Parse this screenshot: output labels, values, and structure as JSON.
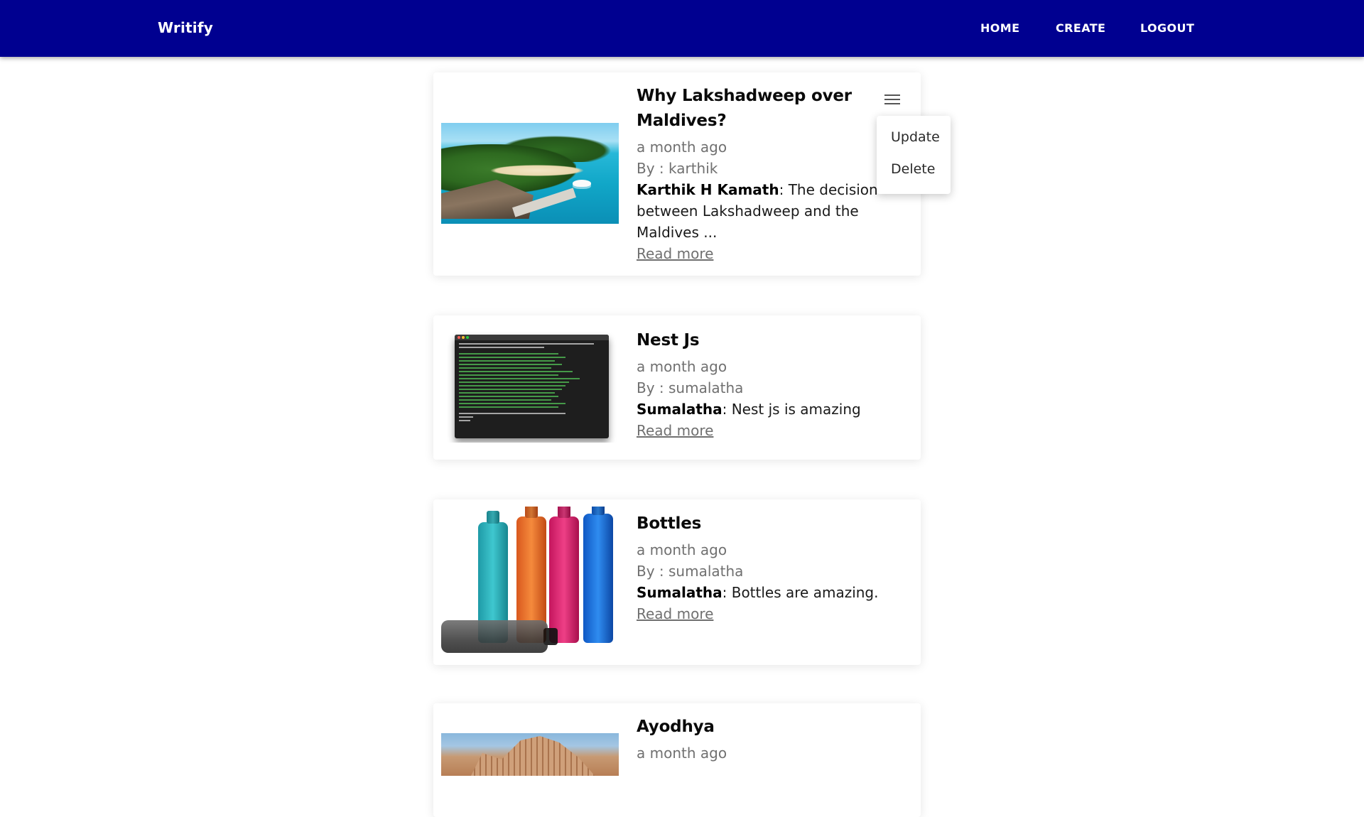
{
  "navbar": {
    "brand": "Writify",
    "links": {
      "home": "HOME",
      "create": "CREATE",
      "logout": "LOGOUT"
    },
    "background": "#000090"
  },
  "posts": [
    {
      "title_line1": "Why Lakshadweep over",
      "title_line2": "Maldives?",
      "time": "a month ago",
      "by": "By : karthik",
      "author": "Karthik H Kamath",
      "excerpt_line1": ": The decision",
      "excerpt_line2": "between Lakshadweep and the",
      "excerpt_line3": "Maldives ...",
      "read_more": "Read more",
      "image_icon": "island-resort-photo"
    },
    {
      "title": "Nest Js",
      "time": "a month ago",
      "by": "By : sumalatha",
      "author": "Sumalatha",
      "excerpt": ": Nest js is amazing",
      "read_more": "Read more",
      "image_icon": "terminal-screenshot"
    },
    {
      "title": "Bottles",
      "time": "a month ago",
      "by": "By : sumalatha",
      "author": "Sumalatha",
      "excerpt": ": Bottles are amazing.",
      "read_more": "Read more",
      "image_icon": "bottles-photo"
    },
    {
      "title": "Ayodhya",
      "time": "a month ago",
      "image_icon": "temple-photo"
    }
  ],
  "post_menu": {
    "icon": "hamburger-menu-icon",
    "items": {
      "update": "Update",
      "delete": "Delete"
    }
  }
}
